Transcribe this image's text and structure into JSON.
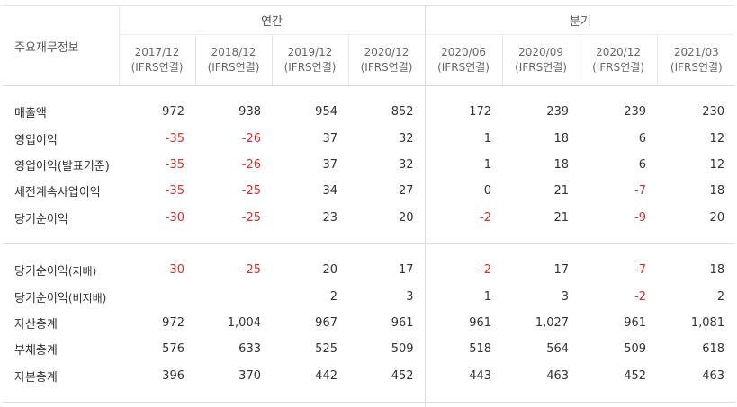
{
  "header": {
    "title": "주요재무정보",
    "group_annual": "연간",
    "group_quarter": "분기",
    "periods": [
      {
        "date": "2017/12",
        "basis": "(IFRS연결)"
      },
      {
        "date": "2018/12",
        "basis": "(IFRS연결)"
      },
      {
        "date": "2019/12",
        "basis": "(IFRS연결)"
      },
      {
        "date": "2020/12",
        "basis": "(IFRS연결)"
      },
      {
        "date": "2020/06",
        "basis": "(IFRS연결)"
      },
      {
        "date": "2020/09",
        "basis": "(IFRS연결)"
      },
      {
        "date": "2020/12",
        "basis": "(IFRS연결)"
      },
      {
        "date": "2021/03",
        "basis": "(IFRS연결)"
      }
    ]
  },
  "section1": [
    {
      "label": "매출액",
      "values": [
        "972",
        "938",
        "954",
        "852",
        "172",
        "239",
        "239",
        "230"
      ]
    },
    {
      "label": "영업이익",
      "values": [
        "-35",
        "-26",
        "37",
        "32",
        "1",
        "18",
        "6",
        "12"
      ]
    },
    {
      "label": "영업이익(발표기준)",
      "values": [
        "-35",
        "-26",
        "37",
        "32",
        "1",
        "18",
        "6",
        "12"
      ]
    },
    {
      "label": "세전계속사업이익",
      "values": [
        "-35",
        "-25",
        "34",
        "27",
        "0",
        "21",
        "-7",
        "18"
      ]
    },
    {
      "label": "당기순이익",
      "values": [
        "-30",
        "-25",
        "23",
        "20",
        "-2",
        "21",
        "-9",
        "20"
      ]
    }
  ],
  "section2": [
    {
      "label": "당기순이익",
      "label_suffix": "(지배)",
      "values": [
        "-30",
        "-25",
        "20",
        "17",
        "-2",
        "17",
        "-7",
        "18"
      ]
    },
    {
      "label": "당기순이익",
      "label_suffix": "(비지배)",
      "values": [
        "",
        "",
        "2",
        "3",
        "1",
        "3",
        "-2",
        "2"
      ]
    },
    {
      "label": "자산총계",
      "values": [
        "972",
        "1,004",
        "967",
        "961",
        "961",
        "1,027",
        "961",
        "1,081"
      ]
    },
    {
      "label": "부채총계",
      "values": [
        "576",
        "633",
        "525",
        "509",
        "518",
        "564",
        "509",
        "618"
      ]
    },
    {
      "label": "자본총계",
      "values": [
        "396",
        "370",
        "442",
        "452",
        "443",
        "463",
        "452",
        "463"
      ]
    }
  ],
  "colors": {
    "negative": "#e02b2b",
    "text": "#333333",
    "border": "#dcdcdc"
  }
}
